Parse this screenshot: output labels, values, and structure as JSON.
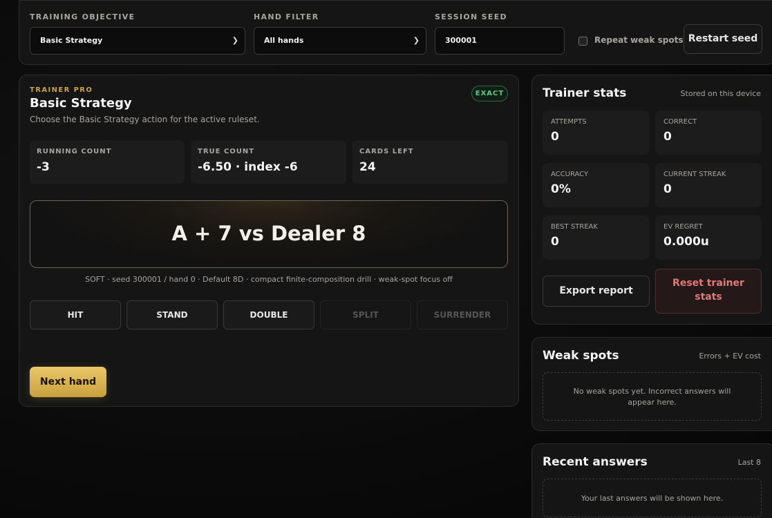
{
  "controls": {
    "objective_label": "TRAINING OBJECTIVE",
    "objective_value": "Basic Strategy",
    "hand_filter_label": "HAND FILTER",
    "hand_filter_value": "All hands",
    "seed_label": "SESSION SEED",
    "seed_value": "300001",
    "repeat_label": "Repeat weak spots",
    "repeat_checked": false,
    "restart_label": "Restart seed"
  },
  "trainer": {
    "eyebrow": "TRAINER PRO",
    "title": "Basic Strategy",
    "subtitle": "Choose the Basic Strategy action for the active ruleset.",
    "badge": "EXACT",
    "stats": [
      {
        "label": "RUNNING COUNT",
        "value": "-3"
      },
      {
        "label": "TRUE COUNT",
        "value": "-6.50 · index -6"
      },
      {
        "label": "CARDS LEFT",
        "value": "24"
      }
    ],
    "hand": "A + 7 vs Dealer 8",
    "hand_meta": "SOFT · seed 300001 / hand 0 · Default 8D · compact finite-composition drill · weak-spot focus off",
    "actions": [
      {
        "label": "HIT",
        "enabled": true
      },
      {
        "label": "STAND",
        "enabled": true
      },
      {
        "label": "DOUBLE",
        "enabled": true
      },
      {
        "label": "SPLIT",
        "enabled": false
      },
      {
        "label": "SURRENDER",
        "enabled": false
      }
    ],
    "next_label": "Next hand"
  },
  "stats_panel": {
    "title": "Trainer stats",
    "note": "Stored on this device",
    "items": [
      {
        "label": "ATTEMPTS",
        "value": "0"
      },
      {
        "label": "CORRECT",
        "value": "0"
      },
      {
        "label": "ACCURACY",
        "value": "0%"
      },
      {
        "label": "CURRENT STREAK",
        "value": "0"
      },
      {
        "label": "BEST STREAK",
        "value": "0"
      },
      {
        "label": "EV REGRET",
        "value": "0.000u"
      }
    ],
    "export_label": "Export report",
    "reset_label": "Reset trainer stats"
  },
  "weak_spots": {
    "title": "Weak spots",
    "note": "Errors + EV cost",
    "empty": "No weak spots yet. Incorrect answers will appear here."
  },
  "recent": {
    "title": "Recent answers",
    "note": "Last 8",
    "empty": "Your last answers will be shown here."
  },
  "colors": {
    "accent_gold": "#c9a24a",
    "exact_green": "#61c985",
    "reset_red": "#e07a7a"
  }
}
